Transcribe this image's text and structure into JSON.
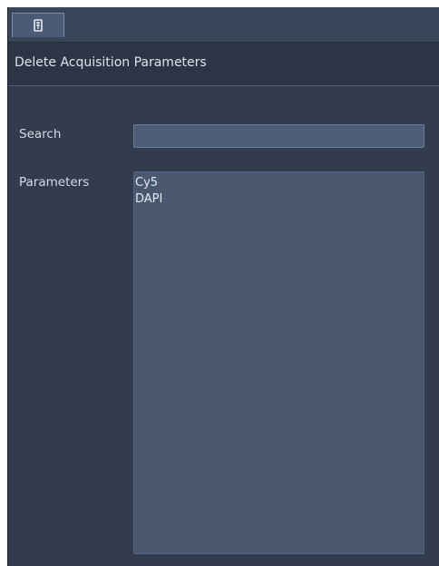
{
  "tabbar": {
    "tabs": [
      {
        "icon": "delete-document-icon"
      }
    ]
  },
  "dialog": {
    "title": "Delete Acquisition Parameters"
  },
  "search": {
    "label": "Search",
    "value": "",
    "placeholder": ""
  },
  "parameters": {
    "label": "Parameters",
    "items": [
      "Cy5",
      "DAPI"
    ]
  },
  "colors": {
    "window_background": "#323c4e",
    "header_background": "#2c3546",
    "input_background": "#4d5c77",
    "list_background": "#49576f",
    "text": "#dfe4ec"
  }
}
